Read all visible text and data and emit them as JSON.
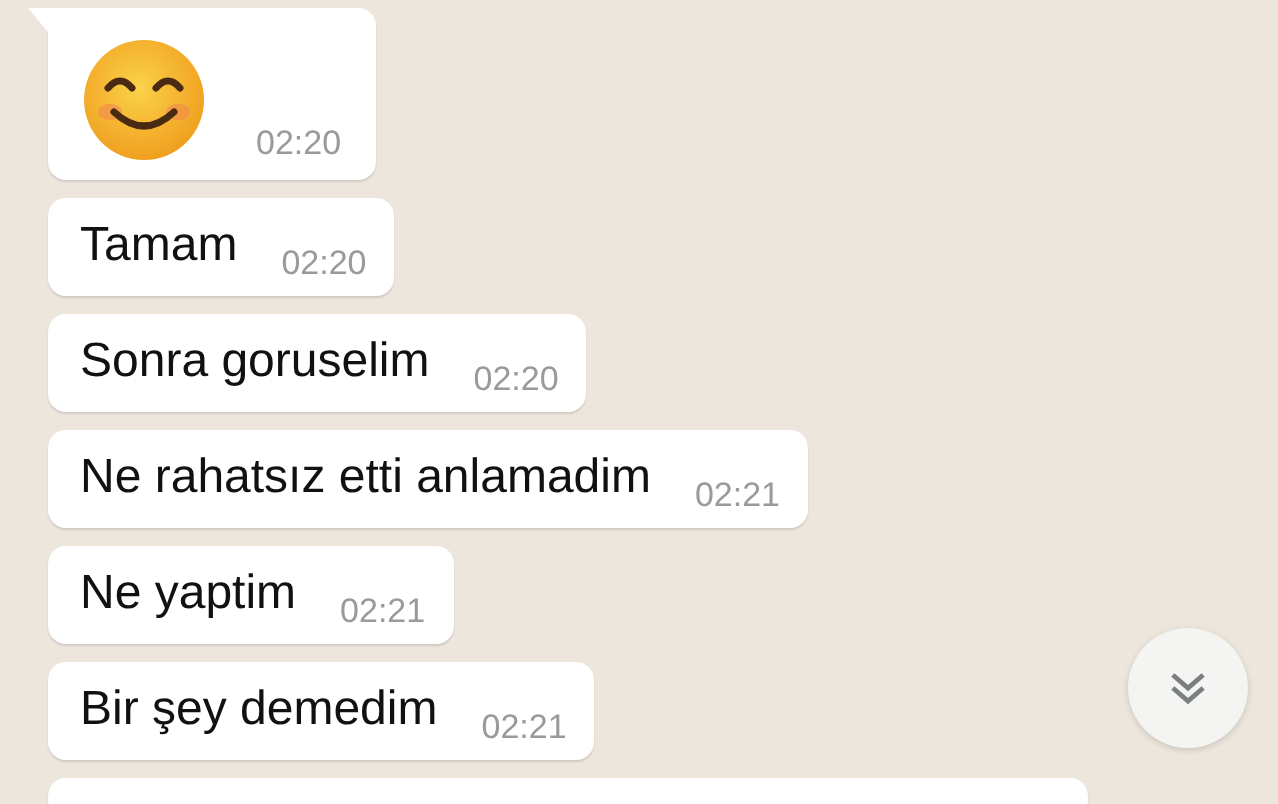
{
  "messages": [
    {
      "kind": "emoji",
      "time": "02:20"
    },
    {
      "kind": "text",
      "text": "Tamam",
      "time": "02:20"
    },
    {
      "kind": "text",
      "text": "Sonra goruselim",
      "time": "02:20"
    },
    {
      "kind": "text",
      "text": "Ne rahatsız etti anlamadim",
      "time": "02:21"
    },
    {
      "kind": "text",
      "text": "Ne yaptim",
      "time": "02:21"
    },
    {
      "kind": "text",
      "text": "Bir şey demedim",
      "time": "02:21"
    },
    {
      "kind": "partial"
    }
  ]
}
